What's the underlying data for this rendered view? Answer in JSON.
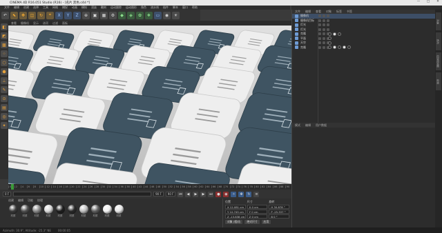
{
  "window": {
    "title": "CINEMA 4D R16.051 Studio (R16) - [名片 黑色.c4d *]",
    "controls": [
      "—",
      "□",
      "✕"
    ]
  },
  "menu": [
    "文件",
    "编辑",
    "创建",
    "选择",
    "工具",
    "网格",
    "捕捉",
    "动画",
    "模拟",
    "渲染",
    "雕刻",
    "运动跟踪",
    "运动图形",
    "角色",
    "流水线",
    "插件",
    "脚本",
    "窗口",
    "帮助"
  ],
  "viewport": {
    "menu": [
      "查看",
      "摄像机",
      "显示",
      "选项",
      "过滤",
      "面板"
    ]
  },
  "timeline": {
    "ticks": [
      "0",
      "2",
      "4",
      "6",
      "8",
      "10",
      "12",
      "14",
      "16",
      "18",
      "20",
      "22",
      "24",
      "26",
      "28",
      "30",
      "32",
      "34",
      "36",
      "38",
      "40",
      "42",
      "44",
      "46",
      "48",
      "50",
      "52",
      "54",
      "56",
      "58",
      "60",
      "62",
      "64",
      "66",
      "68",
      "70",
      "72",
      "74",
      "76",
      "78",
      "80",
      "82",
      "84",
      "86",
      "88",
      "90"
    ]
  },
  "playback": {
    "start": "0 F",
    "current": "0 F",
    "end": "90 F",
    "end2": "90 F"
  },
  "materials": {
    "menu": [
      "创建",
      "编辑",
      "功能",
      "纹理"
    ],
    "items": [
      {
        "label": "材质",
        "color": "#3b3b3b"
      },
      {
        "label": "材质",
        "color": "#505050"
      },
      {
        "label": "材质",
        "color": "#8a8a8a"
      },
      {
        "label": "材质",
        "color": "#d8d8d8"
      },
      {
        "label": "材质",
        "color": "#1e1e1e"
      },
      {
        "label": "材质",
        "color": "#2a2a2a"
      },
      {
        "label": "材质",
        "color": "#c0c0c0"
      },
      {
        "label": "材质",
        "color": "#606060"
      },
      {
        "label": "材质",
        "color": "#f0f0f0"
      },
      {
        "label": "材质",
        "color": "#e6e6e6"
      }
    ]
  },
  "coords": {
    "headers": [
      "位置",
      "尺寸",
      "旋转"
    ],
    "rows": [
      {
        "a": "X 12.081 cm",
        "b": "X 0 cm",
        "c": "H 30.878 °"
      },
      {
        "a": "Y 10.745 cm",
        "b": "Y 0 cm",
        "c": "P -25.337 °"
      },
      {
        "a": "Z -13.838 cm",
        "b": "Z 0 cm",
        "c": "B 0 °"
      }
    ],
    "mode": "对象 (相对)",
    "size_mode": "绝对尺寸",
    "apply": "应用"
  },
  "object_manager": {
    "menu": [
      "文件",
      "编辑",
      "查看",
      "对象",
      "标签",
      "书签"
    ],
    "rows": [
      {
        "name": "摄像机",
        "selected": true
      },
      {
        "name": "摄像机目标",
        "selected": false
      },
      {
        "name": "灯光",
        "selected": false
      },
      {
        "name": "灯光",
        "selected": false
      },
      {
        "name": "克隆",
        "selected": false
      },
      {
        "name": "平面",
        "selected": false
      },
      {
        "name": "天空",
        "selected": false
      },
      {
        "name": "克隆",
        "selected": false
      }
    ]
  },
  "attribute_manager": {
    "menu": [
      "模式",
      "编辑",
      "用户数据"
    ]
  },
  "side_tabs": [
    "对象",
    "场次",
    "内容浏览器",
    "构造"
  ],
  "status": {
    "left": "Azimuth: 30.9°, Altitude: -25.3° NE",
    "right": "00:00:05"
  }
}
